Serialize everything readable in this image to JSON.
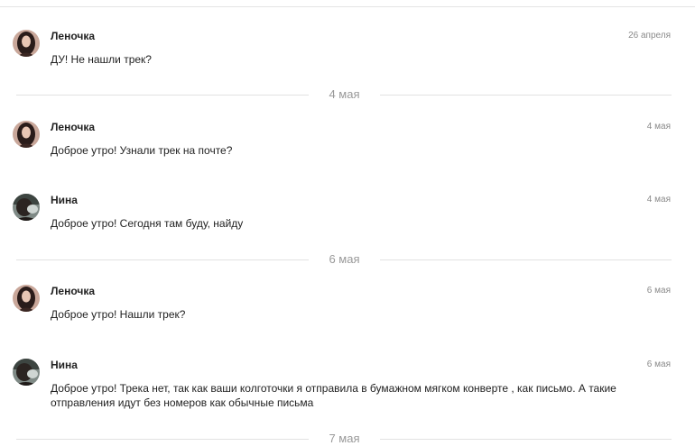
{
  "messages": [
    {
      "author": "Леночка",
      "date": "26 апреля",
      "text": "ДУ! Не нашли трек?"
    },
    {
      "author": "Леночка",
      "date": "4 мая",
      "text": "Доброе утро! Узнали трек на почте?"
    },
    {
      "author": "Нина",
      "date": "4 мая",
      "text": "Доброе утро! Сегодня там буду, найду"
    },
    {
      "author": "Леночка",
      "date": "6 мая",
      "text": "Доброе утро! Нашли трек?"
    },
    {
      "author": "Нина",
      "date": "6 мая",
      "text": "Доброе утро! Трека нет, так как ваши колготочки я отправила в бумажном мягком конверте , как письмо. А такие отправления идут без номеров как обычные письма"
    }
  ],
  "separators": [
    "4 мая",
    "6 мая",
    "7 мая"
  ]
}
